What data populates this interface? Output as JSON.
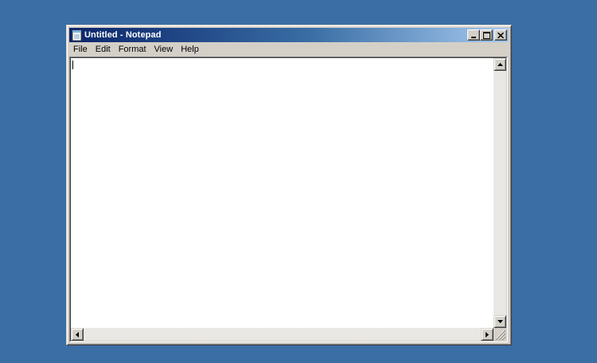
{
  "window": {
    "title": "Untitled - Notepad",
    "icon": "notepad-icon"
  },
  "caption_buttons": [
    {
      "name": "minimize-button",
      "icon": "minimize-icon"
    },
    {
      "name": "maximize-button",
      "icon": "maximize-icon"
    },
    {
      "name": "close-button",
      "icon": "close-icon"
    }
  ],
  "menu": {
    "file": "File",
    "edit": "Edit",
    "format": "Format",
    "view": "View",
    "help": "Help"
  },
  "editor": {
    "content": ""
  },
  "colors": {
    "desktop": "#3a6ea5",
    "title_start": "#0a246a",
    "title_end": "#a6caf0",
    "chrome": "#d4d0c8"
  }
}
